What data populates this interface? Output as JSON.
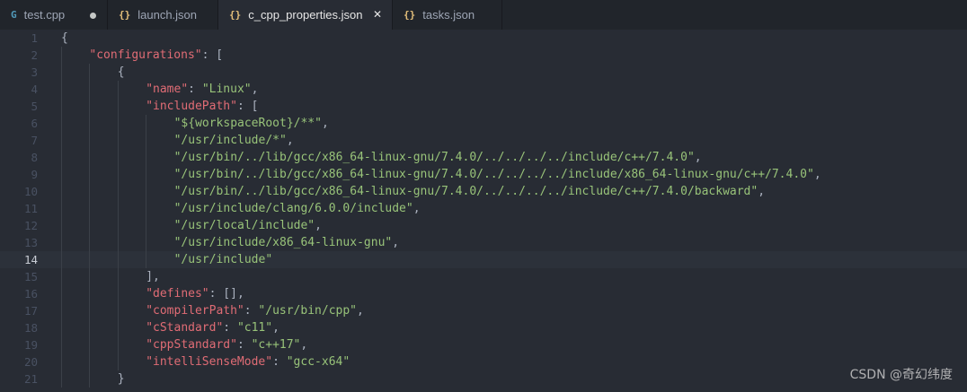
{
  "tabs": [
    {
      "icon": "G",
      "icon_kind": "cpp",
      "label": "test.cpp",
      "state": "dirty",
      "active": false
    },
    {
      "icon": "{}",
      "icon_kind": "json",
      "label": "launch.json",
      "state": "none",
      "active": false
    },
    {
      "icon": "{}",
      "icon_kind": "json",
      "label": "c_cpp_properties.json",
      "state": "close",
      "active": true
    },
    {
      "icon": "{}",
      "icon_kind": "json",
      "label": "tasks.json",
      "state": "none",
      "active": false
    }
  ],
  "editor": {
    "current_line": 14,
    "lines": [
      {
        "n": "1",
        "indent": 0,
        "tokens": [
          [
            "p",
            "{"
          ]
        ]
      },
      {
        "n": "2",
        "indent": 1,
        "tokens": [
          [
            "k",
            "\"configurations\""
          ],
          [
            "p",
            ": ["
          ]
        ]
      },
      {
        "n": "3",
        "indent": 2,
        "tokens": [
          [
            "p",
            "{"
          ]
        ]
      },
      {
        "n": "4",
        "indent": 3,
        "tokens": [
          [
            "k",
            "\"name\""
          ],
          [
            "p",
            ": "
          ],
          [
            "s",
            "\"Linux\""
          ],
          [
            "p",
            ","
          ]
        ]
      },
      {
        "n": "5",
        "indent": 3,
        "tokens": [
          [
            "k",
            "\"includePath\""
          ],
          [
            "p",
            ": ["
          ]
        ]
      },
      {
        "n": "6",
        "indent": 4,
        "tokens": [
          [
            "s",
            "\"${workspaceRoot}/**\""
          ],
          [
            "p",
            ","
          ]
        ]
      },
      {
        "n": "7",
        "indent": 4,
        "tokens": [
          [
            "s",
            "\"/usr/include/*\""
          ],
          [
            "p",
            ","
          ]
        ]
      },
      {
        "n": "8",
        "indent": 4,
        "tokens": [
          [
            "s",
            "\"/usr/bin/../lib/gcc/x86_64-linux-gnu/7.4.0/../../../../include/c++/7.4.0\""
          ],
          [
            "p",
            ","
          ]
        ]
      },
      {
        "n": "9",
        "indent": 4,
        "tokens": [
          [
            "s",
            "\"/usr/bin/../lib/gcc/x86_64-linux-gnu/7.4.0/../../../../include/x86_64-linux-gnu/c++/7.4.0\""
          ],
          [
            "p",
            ","
          ]
        ]
      },
      {
        "n": "10",
        "indent": 4,
        "tokens": [
          [
            "s",
            "\"/usr/bin/../lib/gcc/x86_64-linux-gnu/7.4.0/../../../../include/c++/7.4.0/backward\""
          ],
          [
            "p",
            ","
          ]
        ]
      },
      {
        "n": "11",
        "indent": 4,
        "tokens": [
          [
            "s",
            "\"/usr/include/clang/6.0.0/include\""
          ],
          [
            "p",
            ","
          ]
        ]
      },
      {
        "n": "12",
        "indent": 4,
        "tokens": [
          [
            "s",
            "\"/usr/local/include\""
          ],
          [
            "p",
            ","
          ]
        ]
      },
      {
        "n": "13",
        "indent": 4,
        "tokens": [
          [
            "s",
            "\"/usr/include/x86_64-linux-gnu\""
          ],
          [
            "p",
            ","
          ]
        ]
      },
      {
        "n": "14",
        "indent": 4,
        "tokens": [
          [
            "s",
            "\"/usr/include\""
          ]
        ]
      },
      {
        "n": "15",
        "indent": 3,
        "tokens": [
          [
            "p",
            "],"
          ]
        ]
      },
      {
        "n": "16",
        "indent": 3,
        "tokens": [
          [
            "k",
            "\"defines\""
          ],
          [
            "p",
            ": [],"
          ]
        ]
      },
      {
        "n": "17",
        "indent": 3,
        "tokens": [
          [
            "k",
            "\"compilerPath\""
          ],
          [
            "p",
            ": "
          ],
          [
            "s",
            "\"/usr/bin/cpp\""
          ],
          [
            "p",
            ","
          ]
        ]
      },
      {
        "n": "18",
        "indent": 3,
        "tokens": [
          [
            "k",
            "\"cStandard\""
          ],
          [
            "p",
            ": "
          ],
          [
            "s",
            "\"c11\""
          ],
          [
            "p",
            ","
          ]
        ]
      },
      {
        "n": "19",
        "indent": 3,
        "tokens": [
          [
            "k",
            "\"cppStandard\""
          ],
          [
            "p",
            ": "
          ],
          [
            "s",
            "\"c++17\""
          ],
          [
            "p",
            ","
          ]
        ]
      },
      {
        "n": "20",
        "indent": 3,
        "tokens": [
          [
            "k",
            "\"intelliSenseMode\""
          ],
          [
            "p",
            ": "
          ],
          [
            "s",
            "\"gcc-x64\""
          ]
        ]
      },
      {
        "n": "21",
        "indent": 2,
        "tokens": [
          [
            "p",
            "}"
          ]
        ]
      }
    ]
  },
  "watermark": "CSDN @奇幻纬度"
}
